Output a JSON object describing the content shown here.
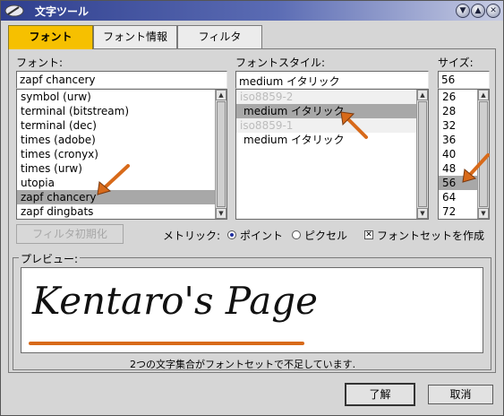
{
  "window": {
    "title": "文字ツール",
    "accent": "#f6c000",
    "controls": {
      "minimize_icon": "chevron-down-icon",
      "maximize_icon": "chevron-up-icon",
      "close_icon": "close-icon"
    }
  },
  "tabs": [
    {
      "label": "フォント",
      "active": true
    },
    {
      "label": "フォント情報",
      "active": false
    },
    {
      "label": "フィルタ",
      "active": false
    }
  ],
  "font": {
    "label": "フォント:",
    "value": "zapf chancery",
    "items": [
      "symbol (urw)",
      "terminal (bitstream)",
      "terminal (dec)",
      "times (adobe)",
      "times (cronyx)",
      "times (urw)",
      "utopia",
      "zapf chancery",
      "zapf dingbats"
    ],
    "selected": "zapf chancery"
  },
  "style": {
    "label": "フォントスタイル:",
    "value": "medium イタリック",
    "items": [
      {
        "text": "iso8859-2",
        "header": true
      },
      {
        "text": "medium イタリック",
        "selected": true
      },
      {
        "text": "iso8859-1",
        "header": true
      },
      {
        "text": "medium イタリック",
        "selected": false
      }
    ]
  },
  "size": {
    "label": "サイズ:",
    "value": "56",
    "items": [
      "26",
      "28",
      "32",
      "36",
      "40",
      "48",
      "56",
      "64",
      "72"
    ],
    "selected": "56"
  },
  "reset_filter": {
    "label": "フィルタ初期化",
    "enabled": false
  },
  "metric": {
    "label": "メトリック:",
    "options": [
      {
        "label": "ポイント",
        "selected": true
      },
      {
        "label": "ピクセル",
        "selected": false
      }
    ]
  },
  "fontset": {
    "label": "フォントセットを作成",
    "checked": true
  },
  "preview": {
    "label": "プレビュー:",
    "text": "Kentaro's Page"
  },
  "status": {
    "text": "2つの文字集合がフォントセットで不足しています."
  },
  "buttons": {
    "ok": "了解",
    "cancel": "取消"
  }
}
